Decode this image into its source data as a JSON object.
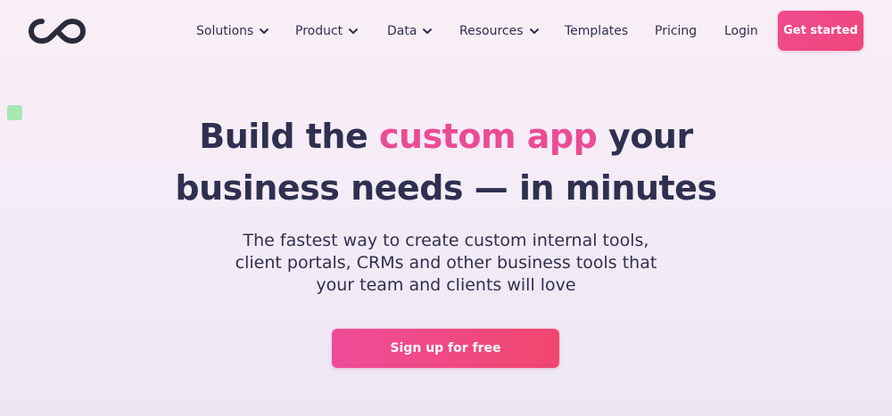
{
  "brand": {
    "logo_icon": "infinity-logo-icon",
    "logo_color": "#2a2b3a"
  },
  "nav": {
    "items": [
      {
        "label": "Solutions",
        "has_dropdown": true
      },
      {
        "label": "Product",
        "has_dropdown": true
      },
      {
        "label": "Data",
        "has_dropdown": true
      },
      {
        "label": "Resources",
        "has_dropdown": true
      },
      {
        "label": "Templates",
        "has_dropdown": false
      },
      {
        "label": "Pricing",
        "has_dropdown": false
      },
      {
        "label": "Login",
        "has_dropdown": false
      }
    ],
    "cta_label": "Get started"
  },
  "hero": {
    "title_part1": "Build the ",
    "title_accent": "custom app",
    "title_part2": " your",
    "title_line2": "business needs — in minutes",
    "subtitle_line1": "The fastest way to create custom internal tools,",
    "subtitle_line2": "client portals, CRMs and other business tools that",
    "subtitle_line3": "your team and clients will love",
    "cta_label": "Sign up for free"
  },
  "colors": {
    "accent": "#ea4c95",
    "text": "#2f3050",
    "cta_gradient_start": "#ee4c98",
    "cta_gradient_end": "#f1466f",
    "decor_square": "#a8e6b4"
  }
}
